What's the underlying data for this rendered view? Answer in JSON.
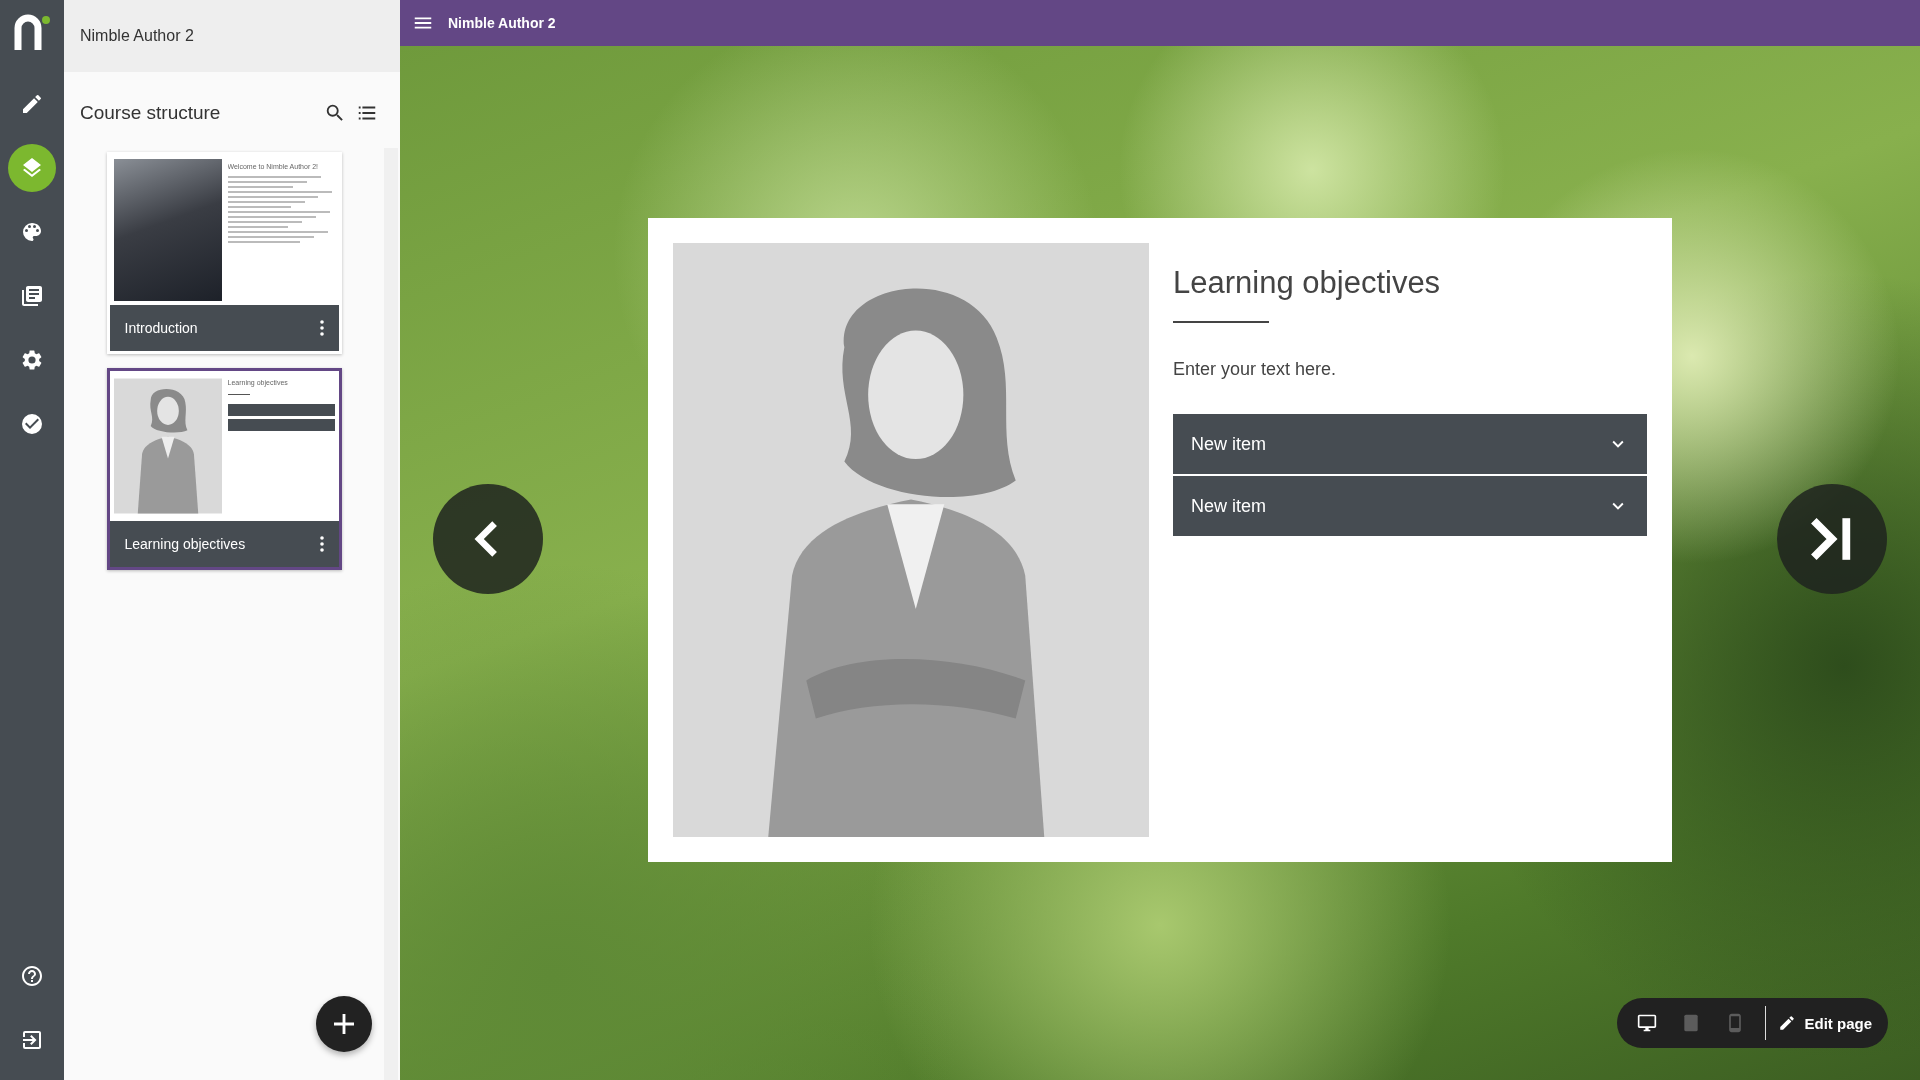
{
  "app": {
    "title": "Nimble Author 2"
  },
  "rail": {
    "items": [
      {
        "kind": "edit",
        "selected": false
      },
      {
        "kind": "layers",
        "selected": true
      },
      {
        "kind": "palette",
        "selected": false
      },
      {
        "kind": "library",
        "selected": false
      },
      {
        "kind": "settings",
        "selected": false
      },
      {
        "kind": "check",
        "selected": false
      }
    ],
    "footer_items": [
      {
        "kind": "help",
        "selected": false
      },
      {
        "kind": "exit",
        "selected": false
      }
    ]
  },
  "sidebar": {
    "heading": "Course structure",
    "pages": [
      {
        "label": "Introduction",
        "thumb_title": "Welcome to Nimble Author 2!",
        "kind": "photo",
        "selected": false
      },
      {
        "label": "Learning objectives",
        "thumb_title": "Learning objectives",
        "kind": "figure",
        "selected": true
      }
    ]
  },
  "topbar": {
    "title": "Nimble Author 2"
  },
  "page": {
    "title": "Learning objectives",
    "body": "Enter your text here.",
    "accordion": [
      {
        "label": "New item",
        "expanded": false
      },
      {
        "label": "New item",
        "expanded": false
      }
    ]
  },
  "toolbar": {
    "devices": [
      {
        "kind": "desktop",
        "selected": true
      },
      {
        "kind": "tablet",
        "selected": false
      },
      {
        "kind": "phone",
        "selected": false
      }
    ],
    "edit_label": "Edit page"
  }
}
